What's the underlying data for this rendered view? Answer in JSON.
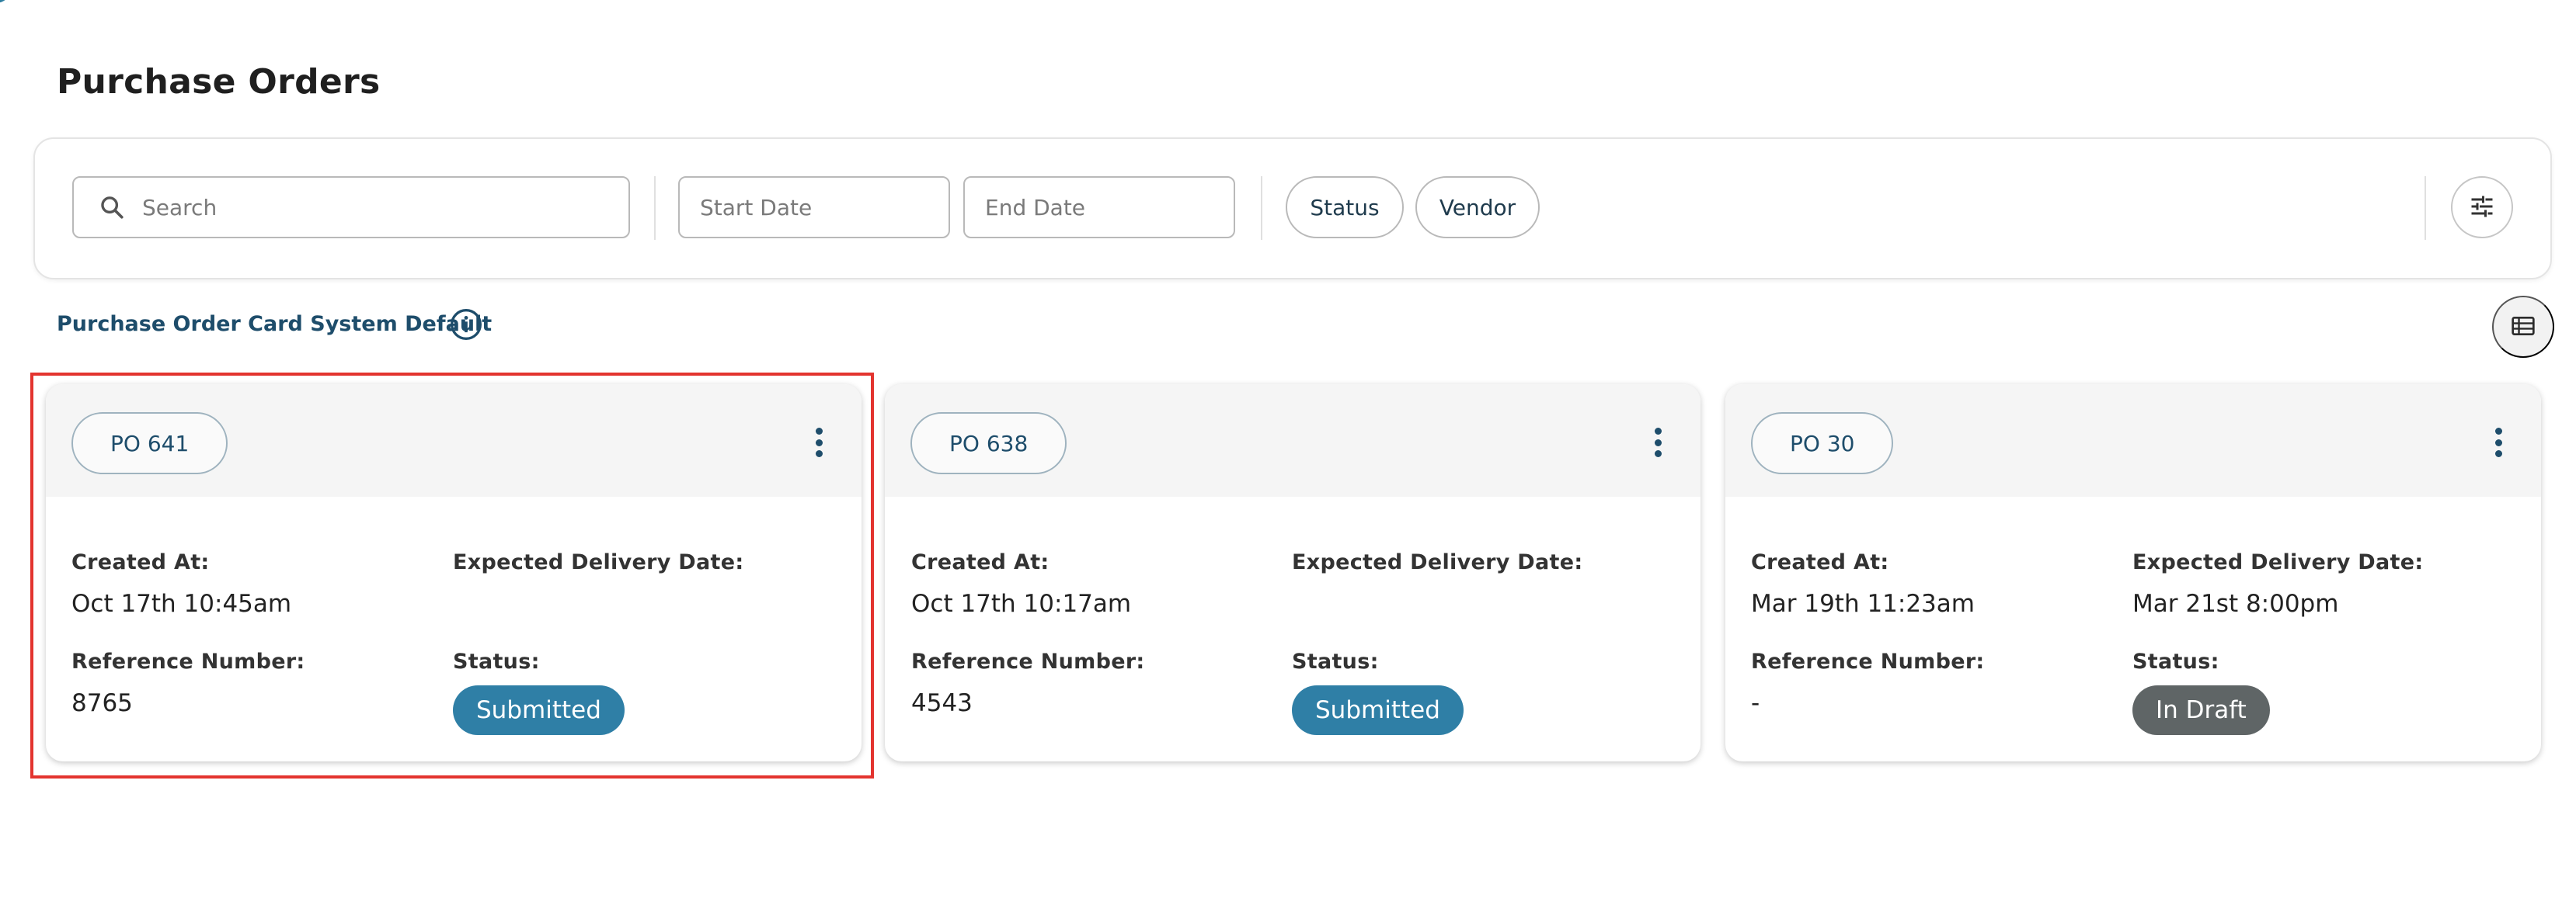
{
  "page": {
    "title": "Purchase Orders"
  },
  "filters": {
    "search_placeholder": "Search",
    "start_date_placeholder": "Start Date",
    "end_date_placeholder": "End Date",
    "status_label": "Status",
    "vendor_label": "Vendor",
    "icons": {
      "search": "search-icon",
      "adjust": "sliders-icon"
    }
  },
  "view": {
    "label": "Purchase Order Card System Default",
    "info_icon": "info-icon",
    "list_icon": "list-view-icon"
  },
  "field_labels": {
    "created_at": "Created At:",
    "expected_delivery": "Expected Delivery Date:",
    "reference_number": "Reference Number:",
    "status": "Status:"
  },
  "cards": [
    {
      "po": "PO 641",
      "created_at": "Oct 17th 10:45am",
      "expected_delivery": "",
      "reference_number": "8765",
      "status": "Submitted",
      "status_color": "#2f7fa6",
      "selected": true
    },
    {
      "po": "PO 638",
      "created_at": "Oct 17th 10:17am",
      "expected_delivery": "",
      "reference_number": "4543",
      "status": "Submitted",
      "status_color": "#2f7fa6",
      "selected": false
    },
    {
      "po": "PO 30",
      "created_at": "Mar 19th 11:23am",
      "expected_delivery": "Mar 21st 8:00pm",
      "reference_number": "-",
      "status": "In Draft",
      "status_color": "#5f6566",
      "selected": false
    }
  ],
  "colors": {
    "accent": "#1e4d6b",
    "submitted": "#2f7fa6",
    "draft": "#5f6566",
    "selection": "#e3342f"
  }
}
